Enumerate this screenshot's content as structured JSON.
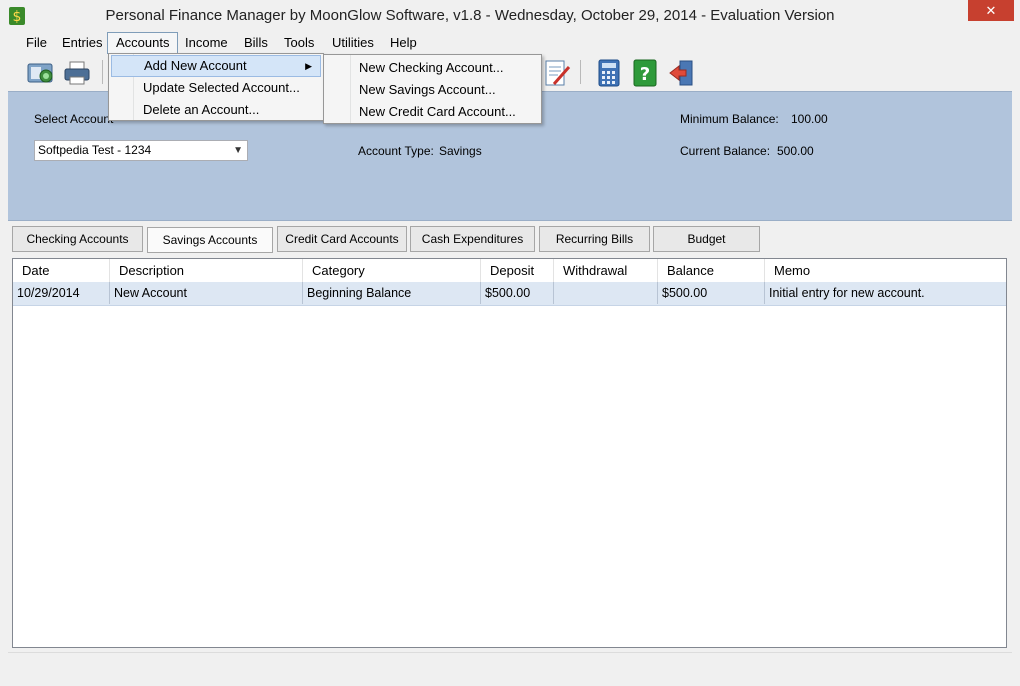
{
  "window": {
    "title": "Personal Finance Manager by MoonGlow Software, v1.8  -  Wednesday, October 29, 2014  -  Evaluation Version",
    "close_glyph": "✕"
  },
  "menu": [
    "File",
    "Entries",
    "Accounts",
    "Income",
    "Bills",
    "Tools",
    "Utilities",
    "Help"
  ],
  "accounts_menu": {
    "items": [
      "Add New Account",
      "Update Selected Account...",
      "Delete an Account..."
    ],
    "submenu": [
      "New Checking Account...",
      "New Savings Account...",
      "New Credit Card Account..."
    ]
  },
  "panel": {
    "select_label": "Select Account",
    "selected_account": "Softpedia Test - 1234",
    "account_type_label": "Account Type:",
    "account_type": "Savings",
    "min_balance_label": "Minimum Balance:",
    "min_balance": "100.00",
    "current_balance_label": "Current Balance:",
    "current_balance": "500.00"
  },
  "tabs": [
    "Checking Accounts",
    "Savings Accounts",
    "Credit Card Accounts",
    "Cash Expenditures",
    "Recurring Bills",
    "Budget"
  ],
  "grid": {
    "columns": [
      "Date",
      "Description",
      "Category",
      "Deposit",
      "Withdrawal",
      "Balance",
      "Memo"
    ],
    "rows": [
      [
        "10/29/2014",
        "New Account",
        "Beginning Balance",
        "$500.00",
        "",
        "$500.00",
        "Initial entry for new account."
      ]
    ]
  },
  "colors": {
    "panel": "#b1c4dc",
    "row_selected": "#dde7f3",
    "close": "#c7402f"
  }
}
